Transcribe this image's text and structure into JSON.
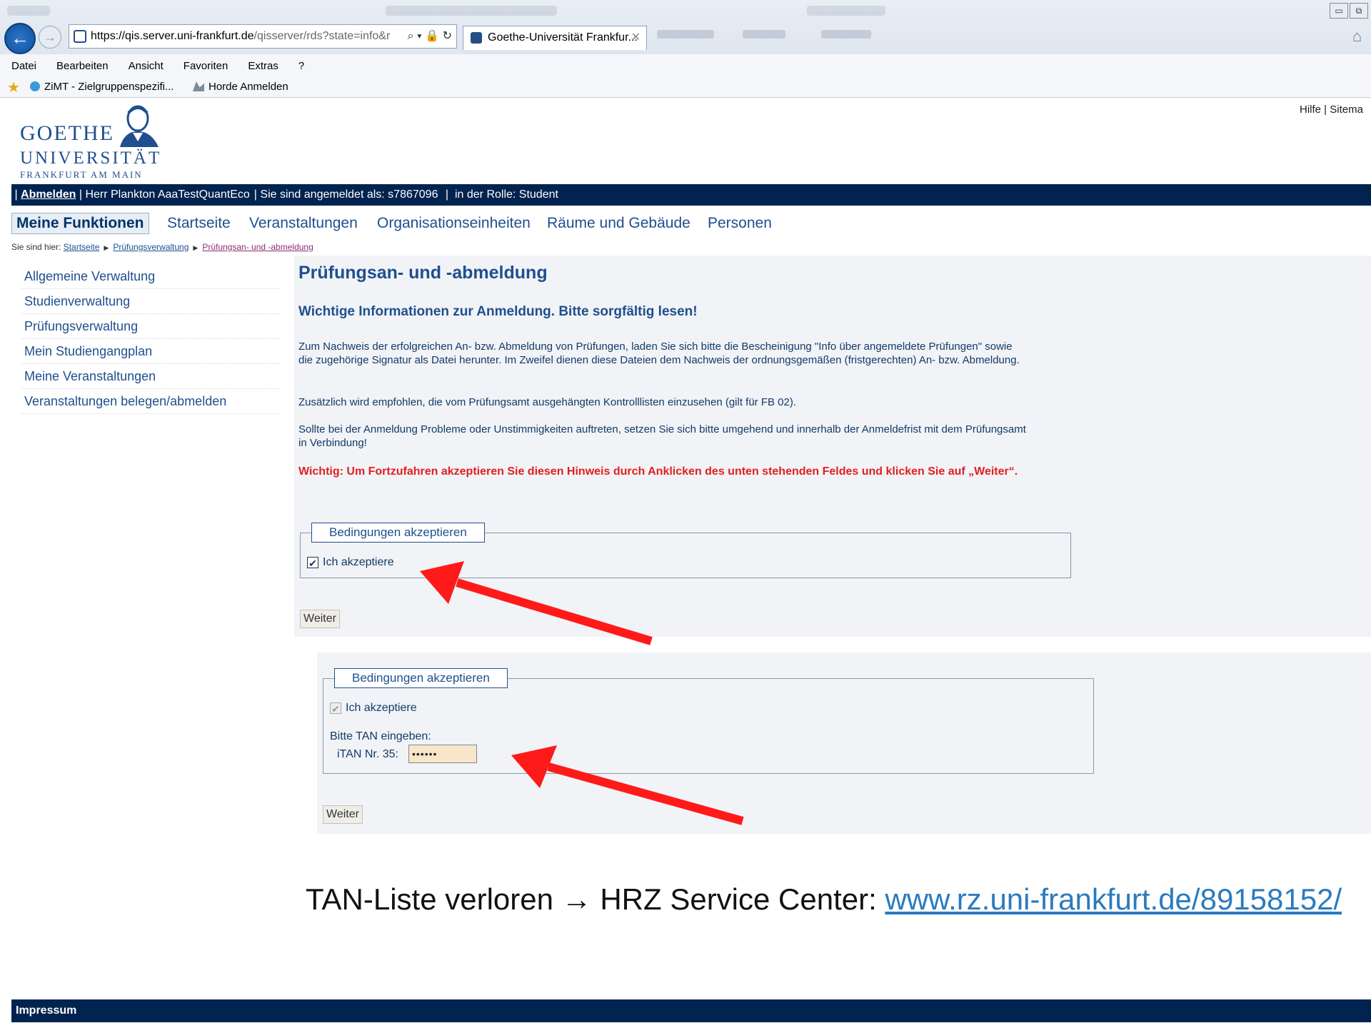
{
  "browser": {
    "url_host": "https://qis.server.uni-frankfurt.de",
    "url_rest": "/qisserver/rds?state=info&r",
    "tab_title": "Goethe-Universität Frankfur...",
    "menu": [
      "Datei",
      "Bearbeiten",
      "Ansicht",
      "Favoriten",
      "Extras",
      "?"
    ],
    "favorites": [
      "ZiMT - Zielgruppenspezifi...",
      "Horde Anmelden"
    ]
  },
  "header": {
    "logo_line1": "GOETHE",
    "logo_line2": "UNIVERSITÄT",
    "logo_line3": "FRANKFURT AM MAIN",
    "help": "Hilfe",
    "sitemap": "Sitema"
  },
  "userbar": {
    "logout": "Abmelden",
    "user": "Herr Plankton AaaTestQuantEco",
    "logged_in": "Sie sind angemeldet als: s7867096",
    "role": "in der Rolle: Student"
  },
  "nav": {
    "active": "Meine Funktionen",
    "items": [
      "Startseite",
      "Veranstaltungen",
      "Organisationseinheiten",
      "Räume und Gebäude",
      "Personen"
    ]
  },
  "breadcrumb": {
    "prefix": "Sie sind hier:",
    "items": [
      "Startseite",
      "Prüfungsverwaltung",
      "Prüfungsan- und -abmeldung"
    ]
  },
  "sidebar": {
    "items": [
      "Allgemeine Verwaltung",
      "Studienverwaltung",
      "Prüfungsverwaltung",
      "Mein Studiengangplan",
      "Meine Veranstaltungen",
      "Veranstaltungen belegen/abmelden"
    ]
  },
  "content": {
    "title": "Prüfungsan- und -abmeldung",
    "subtitle": "Wichtige Informationen zur Anmeldung. Bitte sorgfältig lesen!",
    "p1": "Zum Nachweis der erfolgreichen An- bzw. Abmeldung von Prüfungen, laden Sie sich bitte die Bescheinigung \"Info über angemeldete Prüfungen\" sowie die zugehörige Signatur als Datei herunter. Im Zweifel dienen diese Dateien dem Nachweis der ordnungsgemäßen (fristgerechten) An- bzw. Abmeldung.",
    "p2": "Zusätzlich wird empfohlen, die vom Prüfungsamt ausgehängten Kontrolllisten einzusehen (gilt für FB 02).",
    "p3": "Sollte bei der Anmeldung Probleme oder Unstimmigkeiten auftreten, setzen Sie sich bitte umgehend und innerhalb der Anmeldefrist mit dem Prüfungsamt in Verbindung!",
    "warning": "Wichtig: Um Fortzufahren akzeptieren Sie diesen Hinweis durch Anklicken des unten stehenden Feldes und klicken Sie auf „Weiter“.",
    "legend": "Bedingungen akzeptieren",
    "accept_label": "Ich akzeptiere",
    "next_button": "Weiter"
  },
  "panel2": {
    "legend": "Bedingungen akzeptieren",
    "accept_label": "Ich akzeptiere",
    "tan_prompt": "Bitte TAN eingeben:",
    "itan_label": "iTAN Nr. 35:",
    "tan_value": "••••••",
    "next_button": "Weiter"
  },
  "footnote": {
    "text": "TAN-Liste verloren → HRZ Service Center:",
    "link": "www.rz.uni-frankfurt.de/89158152/"
  },
  "footer": {
    "label": "Impressum"
  },
  "colors": {
    "navy": "#00234f",
    "link_blue": "#1f4f8e",
    "warning_red": "#e02020",
    "arrow_red": "#ff1a1a"
  }
}
